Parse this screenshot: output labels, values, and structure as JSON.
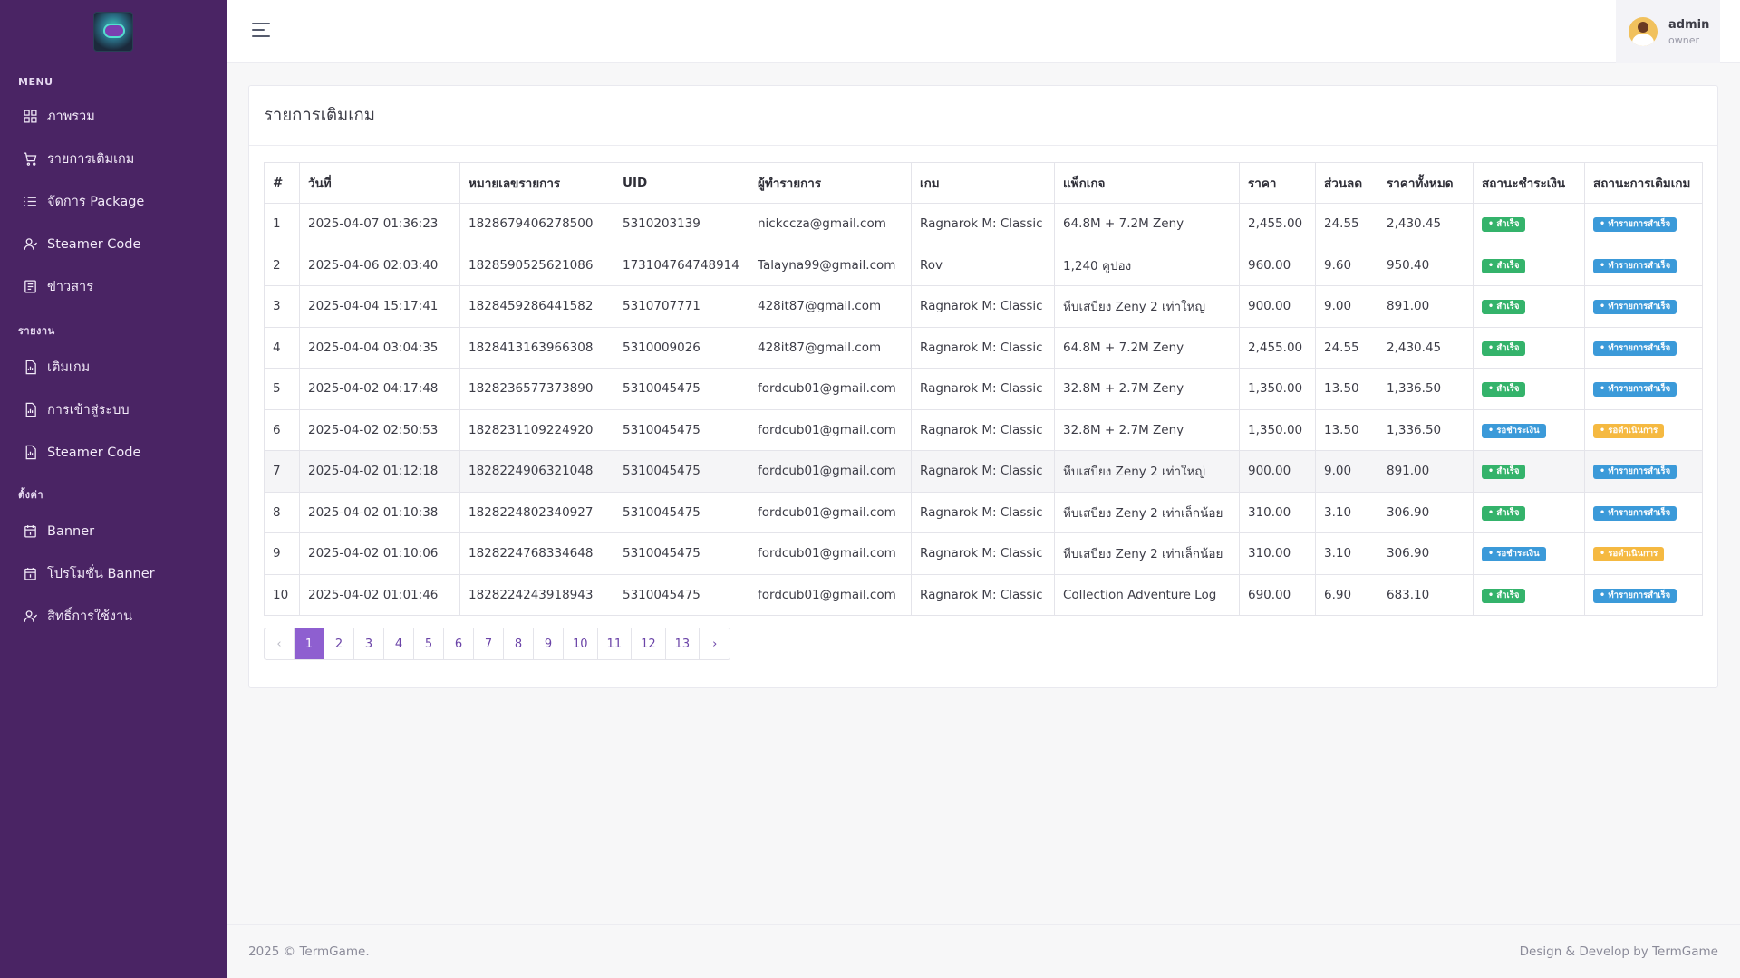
{
  "sidebar": {
    "sections": [
      {
        "title": "MENU",
        "items": [
          {
            "label": "ภาพรวม",
            "icon": "dashboard-icon"
          },
          {
            "label": "รายการเติมเกม",
            "icon": "cart-icon"
          },
          {
            "label": "จัดการ Package",
            "icon": "list-icon"
          },
          {
            "label": "Steamer Code",
            "icon": "user-icon"
          },
          {
            "label": "ข่าวสาร",
            "icon": "news-icon"
          }
        ]
      },
      {
        "title": "รายงาน",
        "items": [
          {
            "label": "เติมเกม",
            "icon": "report-icon"
          },
          {
            "label": "การเข้าสู่ระบบ",
            "icon": "report-icon"
          },
          {
            "label": "Steamer Code",
            "icon": "report-icon"
          }
        ]
      },
      {
        "title": "ตั้งค่า",
        "items": [
          {
            "label": "Banner",
            "icon": "calendar-icon"
          },
          {
            "label": "โปรโมชั่น Banner",
            "icon": "calendar-icon"
          },
          {
            "label": "สิทธิ์การใช้งาน",
            "icon": "user-icon"
          }
        ]
      }
    ]
  },
  "user": {
    "name": "admin",
    "role": "owner"
  },
  "card": {
    "title": "รายการเติมเกม"
  },
  "table": {
    "headers": [
      "#",
      "วันที่",
      "หมายเลขรายการ",
      "UID",
      "ผู้ทำรายการ",
      "เกม",
      "แพ็กเกจ",
      "ราคา",
      "ส่วนลด",
      "ราคาทั้งหมด",
      "สถานะชำระเงิน",
      "สถานะการเติมเกม"
    ],
    "rows": [
      {
        "cells": [
          "1",
          "2025-04-07 01:36:23",
          "1828679406278500",
          "5310203139",
          "nickccza@gmail.com",
          "Ragnarok M: Classic",
          "64.8M + 7.2M Zeny",
          "2,455.00",
          "24.55",
          "2,430.45"
        ],
        "pay": "success",
        "topup": "done"
      },
      {
        "cells": [
          "2",
          "2025-04-06 02:03:40",
          "1828590525621086",
          "173104764748914",
          "Talayna99@gmail.com",
          "Rov",
          "1,240 คูปอง",
          "960.00",
          "9.60",
          "950.40"
        ],
        "pay": "success",
        "topup": "done"
      },
      {
        "cells": [
          "3",
          "2025-04-04 15:17:41",
          "1828459286441582",
          "5310707771",
          "428it87@gmail.com",
          "Ragnarok M: Classic",
          "หีบเสบียง Zeny 2 เท่าใหญ่",
          "900.00",
          "9.00",
          "891.00"
        ],
        "pay": "success",
        "topup": "done"
      },
      {
        "cells": [
          "4",
          "2025-04-04 03:04:35",
          "1828413163966308",
          "5310009026",
          "428it87@gmail.com",
          "Ragnarok M: Classic",
          "64.8M + 7.2M Zeny",
          "2,455.00",
          "24.55",
          "2,430.45"
        ],
        "pay": "success",
        "topup": "done"
      },
      {
        "cells": [
          "5",
          "2025-04-02 04:17:48",
          "1828236577373890",
          "5310045475",
          "fordcub01@gmail.com",
          "Ragnarok M: Classic",
          "32.8M + 2.7M Zeny",
          "1,350.00",
          "13.50",
          "1,336.50"
        ],
        "pay": "success",
        "topup": "done"
      },
      {
        "cells": [
          "6",
          "2025-04-02 02:50:53",
          "1828231109224920",
          "5310045475",
          "fordcub01@gmail.com",
          "Ragnarok M: Classic",
          "32.8M + 2.7M Zeny",
          "1,350.00",
          "13.50",
          "1,336.50"
        ],
        "pay": "pending",
        "topup": "processing"
      },
      {
        "cells": [
          "7",
          "2025-04-02 01:12:18",
          "1828224906321048",
          "5310045475",
          "fordcub01@gmail.com",
          "Ragnarok M: Classic",
          "หีบเสบียง Zeny 2 เท่าใหญ่",
          "900.00",
          "9.00",
          "891.00"
        ],
        "pay": "success",
        "topup": "done"
      },
      {
        "cells": [
          "8",
          "2025-04-02 01:10:38",
          "1828224802340927",
          "5310045475",
          "fordcub01@gmail.com",
          "Ragnarok M: Classic",
          "หีบเสบียง Zeny 2 เท่าเล็กน้อย",
          "310.00",
          "3.10",
          "306.90"
        ],
        "pay": "success",
        "topup": "done"
      },
      {
        "cells": [
          "9",
          "2025-04-02 01:10:06",
          "1828224768334648",
          "5310045475",
          "fordcub01@gmail.com",
          "Ragnarok M: Classic",
          "หีบเสบียง Zeny 2 เท่าเล็กน้อย",
          "310.00",
          "3.10",
          "306.90"
        ],
        "pay": "pending",
        "topup": "processing"
      },
      {
        "cells": [
          "10",
          "2025-04-02 01:01:46",
          "1828224243918943",
          "5310045475",
          "fordcub01@gmail.com",
          "Ragnarok M: Classic",
          "Collection Adventure Log",
          "690.00",
          "6.90",
          "683.10"
        ],
        "pay": "success",
        "topup": "done"
      }
    ]
  },
  "badges": {
    "success": {
      "label": "สำเร็จ",
      "color": "#34b36b"
    },
    "pending": {
      "label": "รอชำระเงิน",
      "color": "#3b9ad9"
    },
    "done": {
      "label": "ทำรายการสำเร็จ",
      "color": "#3b9ad9"
    },
    "processing": {
      "label": "รอดำเนินการ",
      "color": "#f5b941"
    }
  },
  "pagination": {
    "prev": "‹",
    "next": "›",
    "pages": [
      "1",
      "2",
      "3",
      "4",
      "5",
      "6",
      "7",
      "8",
      "9",
      "10",
      "11",
      "12",
      "13"
    ],
    "current": "1"
  },
  "footer": {
    "left": "2025 © TermGame.",
    "right": "Design & Develop by TermGame"
  }
}
